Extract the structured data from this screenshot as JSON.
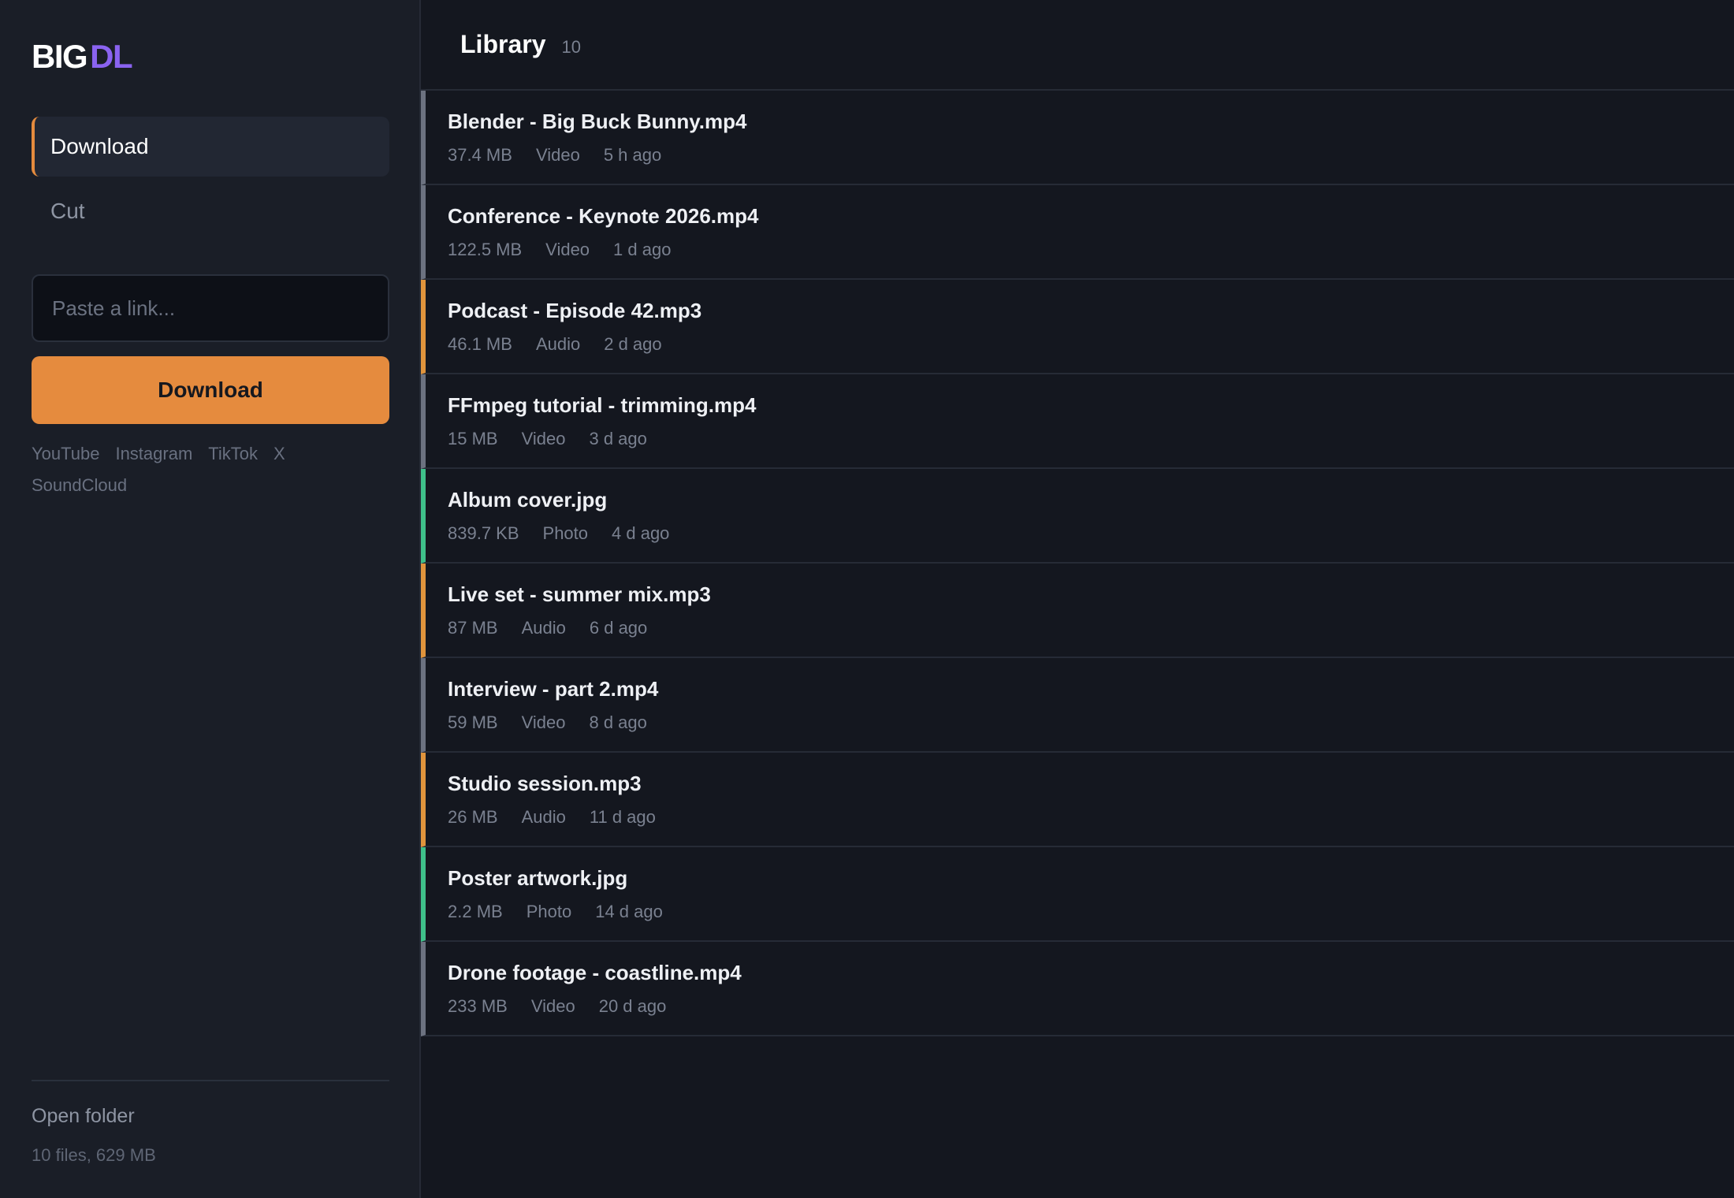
{
  "logo": {
    "part1": "BIG",
    "part2": "DL",
    "accent_color": "#8a63f0"
  },
  "nav": [
    {
      "label": "Download",
      "active": true
    },
    {
      "label": "Cut",
      "active": false
    }
  ],
  "link_input": {
    "placeholder": "Paste a link...",
    "value": ""
  },
  "download_button": {
    "label": "Download",
    "color": "#e58b3e"
  },
  "sources": [
    "YouTube",
    "Instagram",
    "TikTok",
    "X",
    "SoundCloud"
  ],
  "footer": {
    "open_folder": "Open folder",
    "summary": "10 files, 629 MB"
  },
  "library": {
    "title": "Library",
    "count": "10",
    "type_colors": {
      "Video": "#6c7280",
      "Audio": "#e0943c",
      "Photo": "#3fc08a"
    },
    "files": [
      {
        "name": "Blender - Big Buck Bunny.mp4",
        "size": "37.4 MB",
        "type": "Video",
        "age": "5 h ago"
      },
      {
        "name": "Conference - Keynote 2026.mp4",
        "size": "122.5 MB",
        "type": "Video",
        "age": "1 d ago"
      },
      {
        "name": "Podcast - Episode 42.mp3",
        "size": "46.1 MB",
        "type": "Audio",
        "age": "2 d ago"
      },
      {
        "name": "FFmpeg tutorial - trimming.mp4",
        "size": "15 MB",
        "type": "Video",
        "age": "3 d ago"
      },
      {
        "name": "Album cover.jpg",
        "size": "839.7 KB",
        "type": "Photo",
        "age": "4 d ago"
      },
      {
        "name": "Live set - summer mix.mp3",
        "size": "87 MB",
        "type": "Audio",
        "age": "6 d ago"
      },
      {
        "name": "Interview - part 2.mp4",
        "size": "59 MB",
        "type": "Video",
        "age": "8 d ago"
      },
      {
        "name": "Studio session.mp3",
        "size": "26 MB",
        "type": "Audio",
        "age": "11 d ago"
      },
      {
        "name": "Poster artwork.jpg",
        "size": "2.2 MB",
        "type": "Photo",
        "age": "14 d ago"
      },
      {
        "name": "Drone footage - coastline.mp4",
        "size": "233 MB",
        "type": "Video",
        "age": "20 d ago"
      }
    ]
  }
}
